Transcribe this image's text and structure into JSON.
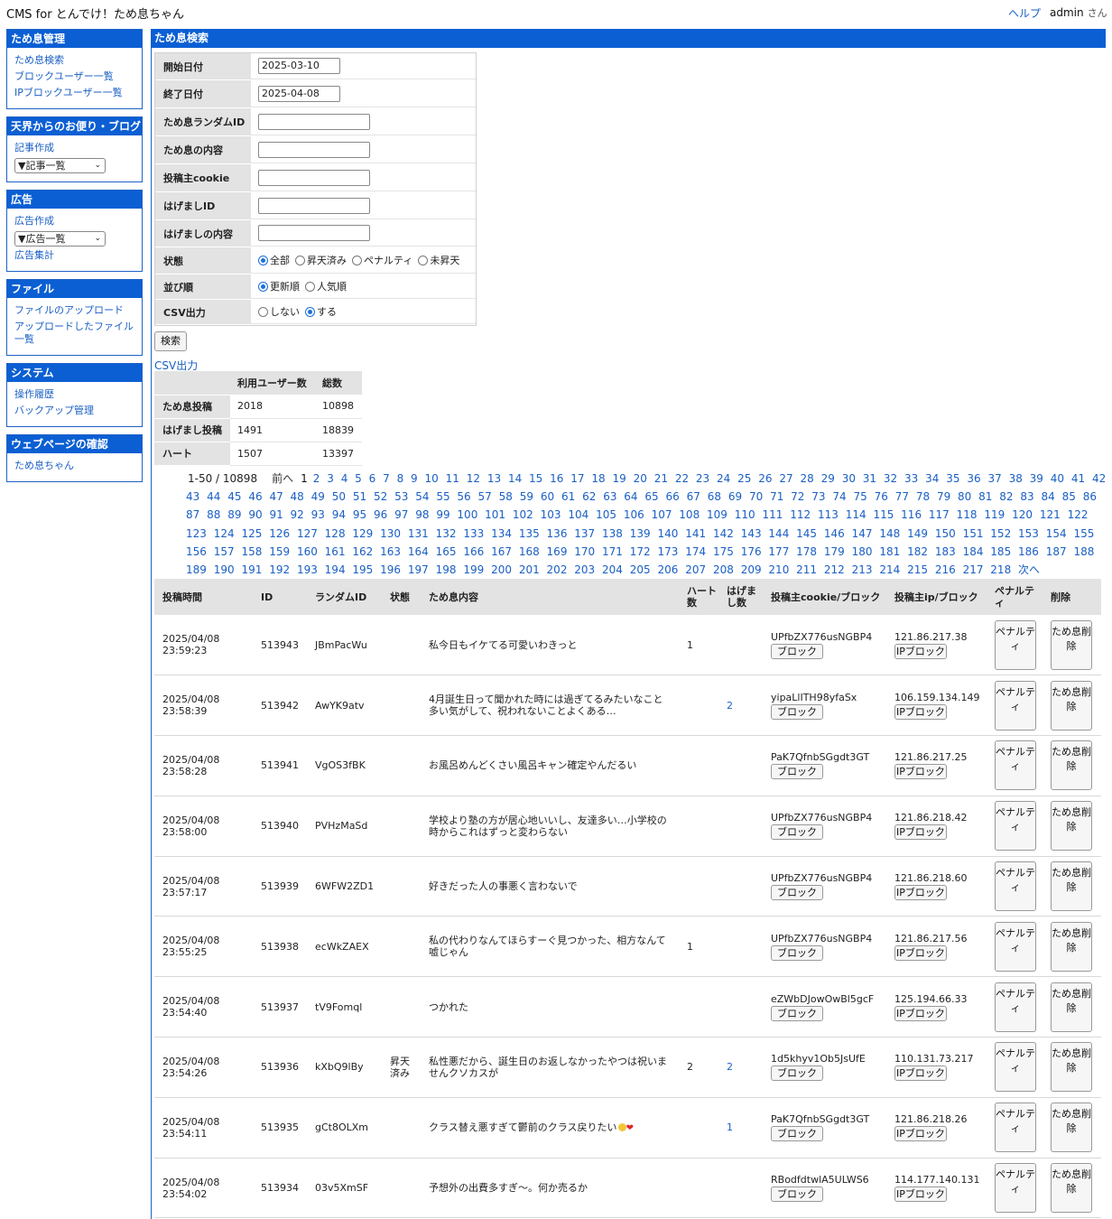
{
  "header": {
    "title": "CMS for とんでけ！ため息ちゃん",
    "help": "ヘルプ",
    "user": "admin",
    "user_suffix": "さん"
  },
  "sidebar": {
    "sections": [
      {
        "title": "ため息管理",
        "items": [
          "ため息検索",
          "ブロックユーザー一覧",
          "IPブロックユーザー一覧"
        ]
      },
      {
        "title": "天界からのお便り・ブログ",
        "items": [
          "記事作成"
        ],
        "select": "▼記事一覧"
      },
      {
        "title": "広告",
        "items": [
          "広告作成"
        ],
        "select": "▼広告一覧",
        "items_after": [
          "広告集計"
        ]
      },
      {
        "title": "ファイル",
        "items": [
          "ファイルのアップロード",
          "アップロードしたファイル一覧"
        ]
      },
      {
        "title": "システム",
        "items": [
          "操作履歴",
          "バックアップ管理"
        ]
      },
      {
        "title": "ウェブページの確認",
        "items": [
          "ため息ちゃん"
        ]
      }
    ]
  },
  "main": {
    "title": "ため息検索"
  },
  "form": {
    "start_date_label": "開始日付",
    "start_date": "2025-03-10",
    "end_date_label": "終了日付",
    "end_date": "2025-04-08",
    "random_id_label": "ため息ランダムID",
    "content_label": "ため息の内容",
    "cookie_label": "投稿主cookie",
    "hagemashi_id_label": "はげましID",
    "hagemashi_content_label": "はげましの内容",
    "status_label": "状態",
    "status_options": [
      "全部",
      "昇天済み",
      "ペナルティ",
      "未昇天"
    ],
    "status_selected": "全部",
    "order_label": "並び順",
    "order_options": [
      "更新順",
      "人気順"
    ],
    "order_selected": "更新順",
    "csv_label": "CSV出力",
    "csv_options": [
      "しない",
      "する"
    ],
    "csv_selected": "する",
    "search_button": "検索",
    "csv_link": "CSV出力"
  },
  "stats": {
    "headers": [
      "利用ユーザー数",
      "総数"
    ],
    "rows": [
      {
        "label": "ため息投稿",
        "users": "2018",
        "total": "10898"
      },
      {
        "label": "はげまし投稿",
        "users": "1491",
        "total": "18839"
      },
      {
        "label": "ハート",
        "users": "1507",
        "total": "13397"
      }
    ]
  },
  "pagination": {
    "range": "1-50 / 10898",
    "prev": "前へ",
    "current": "1",
    "last_page": 218,
    "next": "次へ"
  },
  "table": {
    "headers": {
      "time": "投稿時間",
      "id": "ID",
      "random_id": "ランダムID",
      "status": "状態",
      "content": "ため息内容",
      "hearts": "ハート数",
      "hagemashi": "はげまし数",
      "cookie": "投稿主cookie/ブロック",
      "ip": "投稿主ip/ブロック",
      "penalty": "ペナルティ",
      "delete": "削除"
    },
    "block_button": "ブロック",
    "ip_block_button": "IPブロック",
    "penalty_button": "ペナルティ",
    "delete_button": "ため息削除",
    "rows": [
      {
        "date": "2025/04/08",
        "time": "23:59:23",
        "id": "513943",
        "random_id": "JBmPacWu",
        "status": "",
        "content": "私今日もイケてる可愛いわきっと",
        "hearts": "1",
        "hagemashi": "",
        "cookie": "UPfbZX776usNGBP4",
        "ip": "121.86.217.38"
      },
      {
        "date": "2025/04/08",
        "time": "23:58:39",
        "id": "513942",
        "random_id": "AwYK9atv",
        "status": "",
        "content": "4月誕生日って聞かれた時には過ぎてるみたいなこと多い気がして、祝われないことよくある…",
        "hearts": "",
        "hagemashi": "2",
        "cookie": "yipaLlITH98yfaSx",
        "ip": "106.159.134.149"
      },
      {
        "date": "2025/04/08",
        "time": "23:58:28",
        "id": "513941",
        "random_id": "VgOS3fBK",
        "status": "",
        "content": "お風呂めんどくさい風呂キャン確定やんだるい",
        "hearts": "",
        "hagemashi": "",
        "cookie": "PaK7QfnbSGgdt3GT",
        "ip": "121.86.217.25"
      },
      {
        "date": "2025/04/08",
        "time": "23:58:00",
        "id": "513940",
        "random_id": "PVHzMaSd",
        "status": "",
        "content": "学校より塾の方が居心地いいし、友達多い…小学校の時からこれはずっと変わらない",
        "hearts": "",
        "hagemashi": "",
        "cookie": "UPfbZX776usNGBP4",
        "ip": "121.86.218.42"
      },
      {
        "date": "2025/04/08",
        "time": "23:57:17",
        "id": "513939",
        "random_id": "6WFW2ZD1",
        "status": "",
        "content": "好きだった人の事悪く言わないで",
        "hearts": "",
        "hagemashi": "",
        "cookie": "UPfbZX776usNGBP4",
        "ip": "121.86.218.60"
      },
      {
        "date": "2025/04/08",
        "time": "23:55:25",
        "id": "513938",
        "random_id": "ecWkZAEX",
        "status": "",
        "content": "私の代わりなんてほらすーぐ見つかった、相方なんて嘘じゃん",
        "hearts": "1",
        "hagemashi": "",
        "cookie": "UPfbZX776usNGBP4",
        "ip": "121.86.217.56"
      },
      {
        "date": "2025/04/08",
        "time": "23:54:40",
        "id": "513937",
        "random_id": "tV9Fomql",
        "status": "",
        "content": "つかれた",
        "hearts": "",
        "hagemashi": "",
        "cookie": "eZWbDJowOwBl5gcF",
        "ip": "125.194.66.33"
      },
      {
        "date": "2025/04/08",
        "time": "23:54:26",
        "id": "513936",
        "random_id": "kXbQ9lBy",
        "status": "昇天済み",
        "content": "私性悪だから、誕生日のお返しなかったやつは祝いませんクソカスが",
        "hearts": "2",
        "hagemashi": "2",
        "cookie": "1d5khyv1Ob5JsUfE",
        "ip": "110.131.73.217"
      },
      {
        "date": "2025/04/08",
        "time": "23:54:11",
        "id": "513935",
        "random_id": "gCt8OLXm",
        "status": "",
        "content": "クラス替え悪すぎて鬱前のクラス戻りたい",
        "hearts": "",
        "hagemashi": "1",
        "cookie": "PaK7QfnbSGgdt3GT",
        "ip": "121.86.218.26",
        "emoji": true
      },
      {
        "date": "2025/04/08",
        "time": "23:54:02",
        "id": "513934",
        "random_id": "03v5XmSF",
        "status": "",
        "content": "予想外の出費多すぎ〜。何か売るか",
        "hearts": "",
        "hagemashi": "",
        "cookie": "RBodfdtwlA5ULWS6",
        "ip": "114.177.140.131"
      }
    ]
  }
}
